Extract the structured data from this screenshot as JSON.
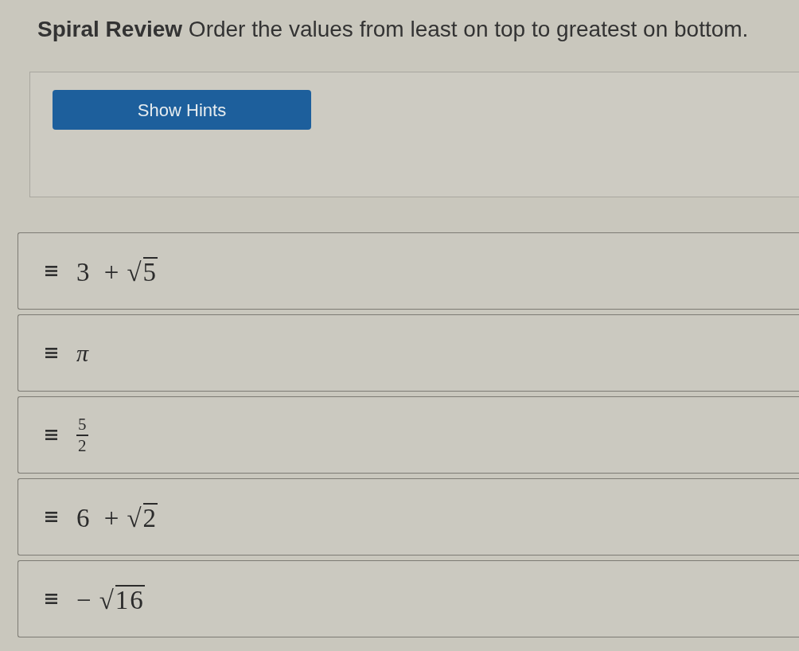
{
  "title": "**Spiral Review** Order the values from least on top to greatest on bottom.",
  "hints_button": {
    "label": "Show Hints"
  },
  "items": [
    {
      "kind": "radical",
      "prefix": "3 +",
      "sign": "√",
      "radicand": "5"
    },
    {
      "kind": "symbol",
      "text": "π"
    },
    {
      "kind": "fraction",
      "numerator": "5",
      "denominator": "2"
    },
    {
      "kind": "radical",
      "prefix": "6 +",
      "sign": "√",
      "radicand": "2"
    },
    {
      "kind": "radical",
      "prefix": "−",
      "sign": "√",
      "radicand": "16"
    }
  ]
}
